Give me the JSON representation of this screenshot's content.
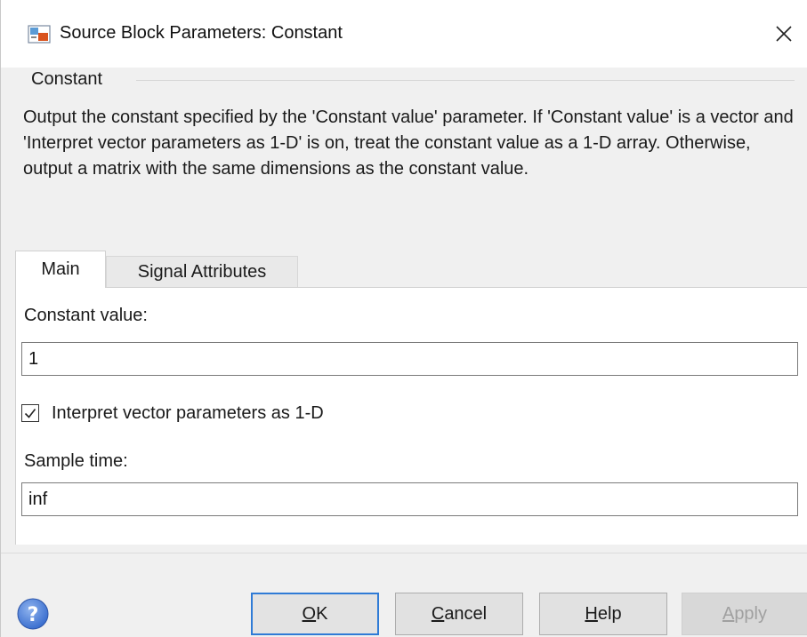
{
  "window": {
    "title": "Source Block Parameters: Constant",
    "icon": "simulink-block-icon",
    "close_icon": "close-icon"
  },
  "block": {
    "name": "Constant",
    "description": "Output the constant specified by the 'Constant value' parameter. If 'Constant value' is a vector and 'Interpret vector parameters as 1-D' is on, treat the constant value as a 1-D array. Otherwise, output a matrix with the same dimensions as the constant value."
  },
  "tabs": [
    {
      "label": "Main",
      "active": true
    },
    {
      "label": "Signal Attributes",
      "active": false
    }
  ],
  "main": {
    "constant_value_label": "Constant value:",
    "constant_value": "1",
    "interpret_vector_label": "Interpret vector parameters as 1-D",
    "interpret_vector_checked": true,
    "sample_time_label": "Sample time:",
    "sample_time": "inf"
  },
  "footer": {
    "help_icon": "help-icon",
    "ok": {
      "mnemonic": "O",
      "rest": "K"
    },
    "cancel": {
      "mnemonic": "C",
      "rest": "ancel"
    },
    "help": {
      "mnemonic": "H",
      "rest": "elp"
    },
    "apply": {
      "mnemonic": "A",
      "rest": "pply"
    }
  },
  "colors": {
    "default_button_border": "#2f7bd6",
    "help_icon_blue": "#3b6fcf",
    "disabled_text": "#a0a0a0"
  }
}
